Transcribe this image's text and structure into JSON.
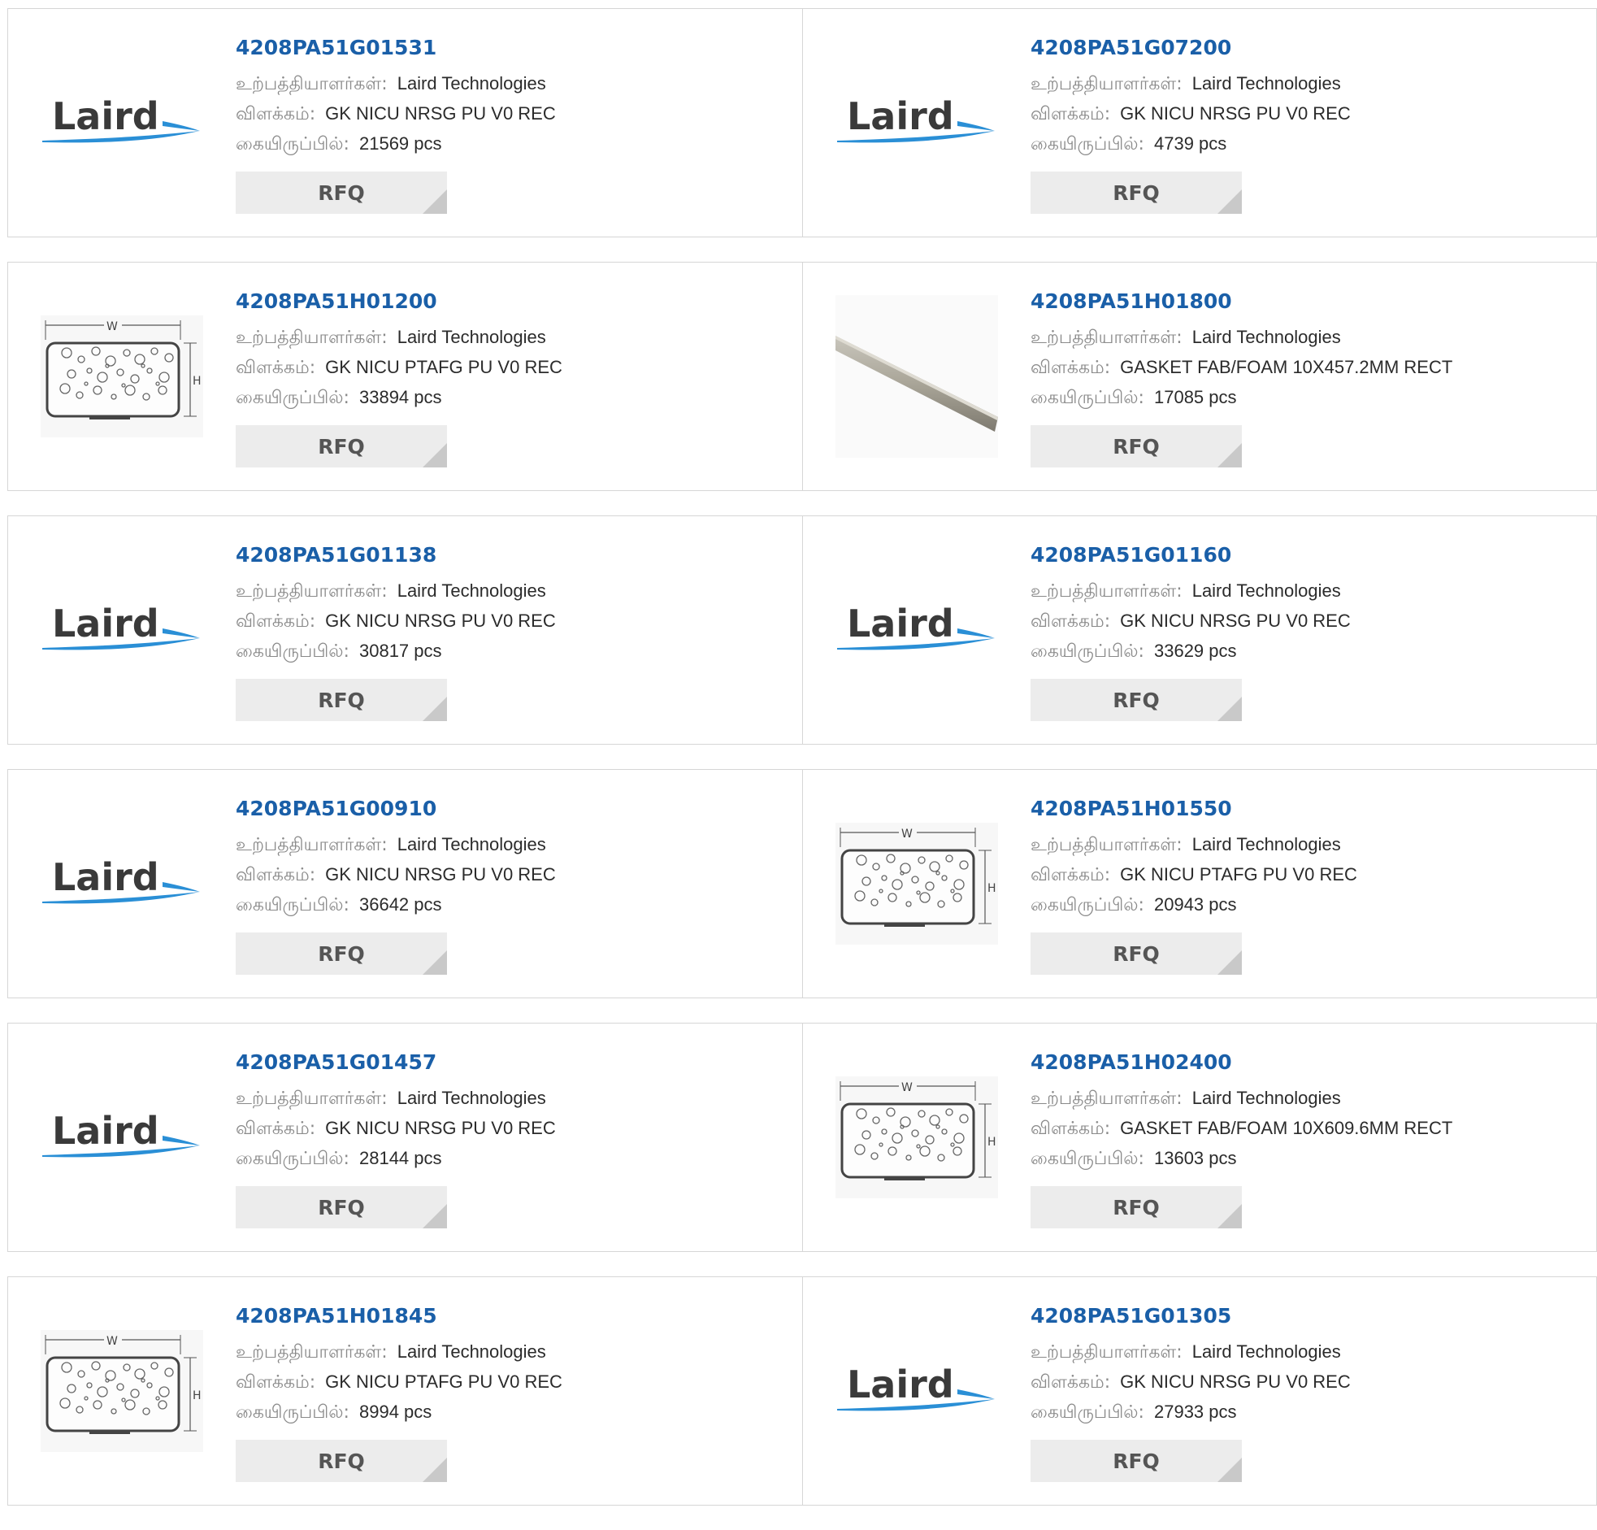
{
  "labels": {
    "manufacturer": "உற்பத்தியாளர்கள்:",
    "description": "விளக்கம்:",
    "stock": "கையிருப்பில்:",
    "rfq": "RFQ"
  },
  "logo_text": "Laird",
  "colors": {
    "part_link": "#1a5fa8",
    "logo_swoosh": "#2a8fd6",
    "button_bg": "#ececec",
    "border": "#d6d6d6"
  },
  "rows": [
    {
      "items": [
        {
          "part": "4208PA51G01531",
          "manufacturer": "Laird Technologies",
          "description": "GK NICU NRSG PU V0 REC",
          "stock": "21569 pcs",
          "image": "laird-logo"
        },
        {
          "part": "4208PA51G07200",
          "manufacturer": "Laird Technologies",
          "description": "GK NICU NRSG PU V0 REC",
          "stock": "4739 pcs",
          "image": "laird-logo"
        }
      ]
    },
    {
      "items": [
        {
          "part": "4208PA51H01200",
          "manufacturer": "Laird Technologies",
          "description": "GK NICU PTAFG PU V0 REC",
          "stock": "33894 pcs",
          "image": "gasket-diagram"
        },
        {
          "part": "4208PA51H01800",
          "manufacturer": "Laird Technologies",
          "description": "GASKET FAB/FOAM 10X457.2MM RECT",
          "stock": "17085 pcs",
          "image": "gasket-strip-photo"
        }
      ]
    },
    {
      "items": [
        {
          "part": "4208PA51G01138",
          "manufacturer": "Laird Technologies",
          "description": "GK NICU NRSG PU V0 REC",
          "stock": "30817 pcs",
          "image": "laird-logo"
        },
        {
          "part": "4208PA51G01160",
          "manufacturer": "Laird Technologies",
          "description": "GK NICU NRSG PU V0 REC",
          "stock": "33629 pcs",
          "image": "laird-logo"
        }
      ]
    },
    {
      "items": [
        {
          "part": "4208PA51G00910",
          "manufacturer": "Laird Technologies",
          "description": "GK NICU NRSG PU V0 REC",
          "stock": "36642 pcs",
          "image": "laird-logo"
        },
        {
          "part": "4208PA51H01550",
          "manufacturer": "Laird Technologies",
          "description": "GK NICU PTAFG PU V0 REC",
          "stock": "20943 pcs",
          "image": "gasket-diagram"
        }
      ]
    },
    {
      "items": [
        {
          "part": "4208PA51G01457",
          "manufacturer": "Laird Technologies",
          "description": "GK NICU NRSG PU V0 REC",
          "stock": "28144 pcs",
          "image": "laird-logo"
        },
        {
          "part": "4208PA51H02400",
          "manufacturer": "Laird Technologies",
          "description": "GASKET FAB/FOAM 10X609.6MM RECT",
          "stock": "13603 pcs",
          "image": "gasket-diagram"
        }
      ]
    },
    {
      "items": [
        {
          "part": "4208PA51H01845",
          "manufacturer": "Laird Technologies",
          "description": "GK NICU PTAFG PU V0 REC",
          "stock": "8994 pcs",
          "image": "gasket-diagram"
        },
        {
          "part": "4208PA51G01305",
          "manufacturer": "Laird Technologies",
          "description": "GK NICU NRSG PU V0 REC",
          "stock": "27933 pcs",
          "image": "laird-logo"
        }
      ]
    }
  ]
}
